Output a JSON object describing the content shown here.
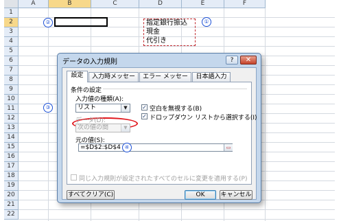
{
  "sheet": {
    "columns": [
      "A",
      "B",
      "C",
      "D",
      "E",
      "F"
    ],
    "rows": [
      "1",
      "2",
      "3",
      "4",
      "5",
      "6",
      "7",
      "8",
      "9",
      "10",
      "11",
      "12",
      "13",
      "14",
      "15",
      "16",
      "17",
      "18",
      "19",
      "20",
      "21",
      "22"
    ],
    "list_values": [
      "指定銀行振込",
      "現金",
      "代引き"
    ],
    "markers": {
      "m1": "①",
      "m2": "②",
      "m3": "③",
      "m4": "④"
    }
  },
  "dialog": {
    "title": "データの入力規則",
    "help_label": "?",
    "close_label": "✕",
    "tabs": [
      "設定",
      "入力時メッセージ",
      "エラー メッセージ",
      "日本語入力"
    ],
    "group_title": "条件の設定",
    "allow_label": "入力値の種類(A):",
    "allow_value": "リスト",
    "data_label": "データ(D):",
    "data_value": "次の値の間",
    "ignore_blank_label": "空白を無視する(B)",
    "ignore_blank_checked": true,
    "dropdown_label": "ドロップダウン リストから選択する(I)",
    "dropdown_checked": true,
    "source_label": "元の値(S):",
    "source_value": "=$D$2:$D$4",
    "apply_all_label": "同じ入力規則が設定されたすべてのセルに変更を適用する(P)",
    "apply_all_checked": false,
    "clear_all_label": "すべてクリア(C)",
    "ok_label": "OK",
    "cancel_label": "キャンセル",
    "check_glyph": "✓",
    "dropdown_arrow": "▼",
    "collapse_icon": "collapse-dialog-icon"
  },
  "colors": {
    "accent_red": "#e1171d",
    "marker_blue": "#1a4fd6",
    "header_selected": "#f7d88a"
  }
}
